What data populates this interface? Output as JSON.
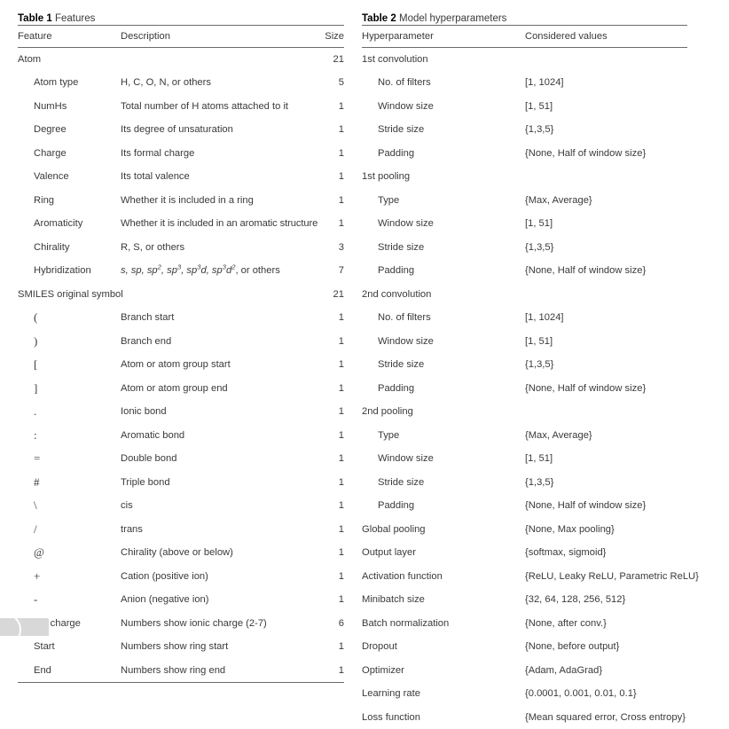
{
  "table1": {
    "caption_label": "Table 1",
    "caption_title": "Features",
    "headers": {
      "feature": "Feature",
      "description": "Description",
      "size": "Size"
    },
    "rows": [
      {
        "kind": "group",
        "feature": "Atom",
        "description": "",
        "size": "21"
      },
      {
        "kind": "sub",
        "feature": "Atom type",
        "description": "H, C, O, N, or others",
        "size": "5"
      },
      {
        "kind": "sub",
        "feature": "NumHs",
        "description": "Total number of H atoms attached to it",
        "size": "1"
      },
      {
        "kind": "sub",
        "feature": "Degree",
        "description": "Its degree of unsaturation",
        "size": "1"
      },
      {
        "kind": "sub",
        "feature": "Charge",
        "description": "Its formal charge",
        "size": "1"
      },
      {
        "kind": "sub",
        "feature": "Valence",
        "description": "Its total valence",
        "size": "1"
      },
      {
        "kind": "sub",
        "feature": "Ring",
        "description": "Whether it is included in a ring",
        "size": "1"
      },
      {
        "kind": "sub",
        "feature": "Aromaticity",
        "description": "Whether it is included in an aromatic structure",
        "size": "1"
      },
      {
        "kind": "sub",
        "feature": "Chirality",
        "description": "R, S, or others",
        "size": "3"
      },
      {
        "kind": "hybrid",
        "feature": "Hybridization",
        "description": "s, sp, sp2, sp3, sp3d, sp3d2, or others",
        "size": "7"
      },
      {
        "kind": "group",
        "feature": "SMILES original symbol",
        "description": "",
        "size": "21"
      },
      {
        "kind": "symbol",
        "feature": "(",
        "description": "Branch start",
        "size": "1"
      },
      {
        "kind": "symbol",
        "feature": ")",
        "description": "Branch end",
        "size": "1"
      },
      {
        "kind": "symbol",
        "feature": "[",
        "description": "Atom or atom group start",
        "size": "1"
      },
      {
        "kind": "symbol",
        "feature": "]",
        "description": "Atom or atom group end",
        "size": "1"
      },
      {
        "kind": "symbol",
        "feature": ".",
        "description": "Ionic bond",
        "size": "1"
      },
      {
        "kind": "symbol",
        "feature": ":",
        "description": "Aromatic bond",
        "size": "1"
      },
      {
        "kind": "symbol",
        "feature": "=",
        "description": "Double bond",
        "size": "1"
      },
      {
        "kind": "symbol",
        "feature": "#",
        "description": "Triple bond",
        "size": "1"
      },
      {
        "kind": "symbol",
        "feature": "\\",
        "description": "cis",
        "size": "1"
      },
      {
        "kind": "symbol",
        "feature": "/",
        "description": "trans",
        "size": "1"
      },
      {
        "kind": "symbol",
        "feature": "@",
        "description": "Chirality (above or below)",
        "size": "1"
      },
      {
        "kind": "symbol",
        "feature": "+",
        "description": "Cation (positive ion)",
        "size": "1"
      },
      {
        "kind": "symbol",
        "feature": "-",
        "description": "Anion (negative ion)",
        "size": "1"
      },
      {
        "kind": "sub",
        "feature": "Ion charge",
        "description": "Numbers show ionic charge (2-7)",
        "size": "6"
      },
      {
        "kind": "sub",
        "feature": "Start",
        "description": "Numbers show ring start",
        "size": "1"
      },
      {
        "kind": "sub",
        "feature": "End",
        "description": "Numbers show ring end",
        "size": "1"
      }
    ]
  },
  "table2": {
    "caption_label": "Table 2",
    "caption_title": "Model hyperparameters",
    "headers": {
      "hyperparameter": "Hyperparameter",
      "values": "Considered values"
    },
    "rows": [
      {
        "kind": "group",
        "name": "1st convolution",
        "value": ""
      },
      {
        "kind": "sub",
        "name": "No. of filters",
        "value": "[1, 1024]"
      },
      {
        "kind": "sub",
        "name": "Window size",
        "value": "[1, 51]"
      },
      {
        "kind": "sub",
        "name": "Stride size",
        "value": "{1,3,5}"
      },
      {
        "kind": "sub",
        "name": "Padding",
        "value": "{None, Half of window size}"
      },
      {
        "kind": "group",
        "name": "1st pooling",
        "value": ""
      },
      {
        "kind": "sub",
        "name": "Type",
        "value": "{Max, Average}"
      },
      {
        "kind": "sub",
        "name": "Window size",
        "value": "[1, 51]"
      },
      {
        "kind": "sub",
        "name": "Stride size",
        "value": "{1,3,5}"
      },
      {
        "kind": "sub",
        "name": "Padding",
        "value": "{None, Half of window size}"
      },
      {
        "kind": "group",
        "name": "2nd convolution",
        "value": ""
      },
      {
        "kind": "sub",
        "name": "No. of filters",
        "value": "[1, 1024]"
      },
      {
        "kind": "sub",
        "name": "Window size",
        "value": "[1, 51]"
      },
      {
        "kind": "sub",
        "name": "Stride size",
        "value": "{1,3,5}"
      },
      {
        "kind": "sub",
        "name": "Padding",
        "value": "{None, Half of window size}"
      },
      {
        "kind": "group",
        "name": "2nd pooling",
        "value": ""
      },
      {
        "kind": "sub",
        "name": "Type",
        "value": "{Max, Average}"
      },
      {
        "kind": "sub",
        "name": "Window size",
        "value": "[1, 51]"
      },
      {
        "kind": "sub",
        "name": "Stride size",
        "value": "{1,3,5}"
      },
      {
        "kind": "sub",
        "name": "Padding",
        "value": "{None, Half of window size}"
      },
      {
        "kind": "flat",
        "name": "Global pooling",
        "value": "{None, Max pooling}"
      },
      {
        "kind": "flat",
        "name": "Output layer",
        "value": "{softmax, sigmoid}"
      },
      {
        "kind": "flat",
        "name": "Activation function",
        "value": "{ReLU, Leaky ReLU, Parametric ReLU}"
      },
      {
        "kind": "flat",
        "name": "Minibatch size",
        "value": "{32, 64, 128, 256, 512}"
      },
      {
        "kind": "flat",
        "name": "Batch normalization",
        "value": "{None, after conv.}"
      },
      {
        "kind": "flat",
        "name": "Dropout",
        "value": "{None, before output}"
      },
      {
        "kind": "flat",
        "name": "Optimizer",
        "value": "{Adam, AdaGrad}"
      },
      {
        "kind": "flat",
        "name": "Learning rate",
        "value": "{0.0001, 0.001, 0.01, 0.1}"
      },
      {
        "kind": "flat",
        "name": "Loss function",
        "value": "{Mean squared error, Cross entropy}"
      }
    ]
  }
}
